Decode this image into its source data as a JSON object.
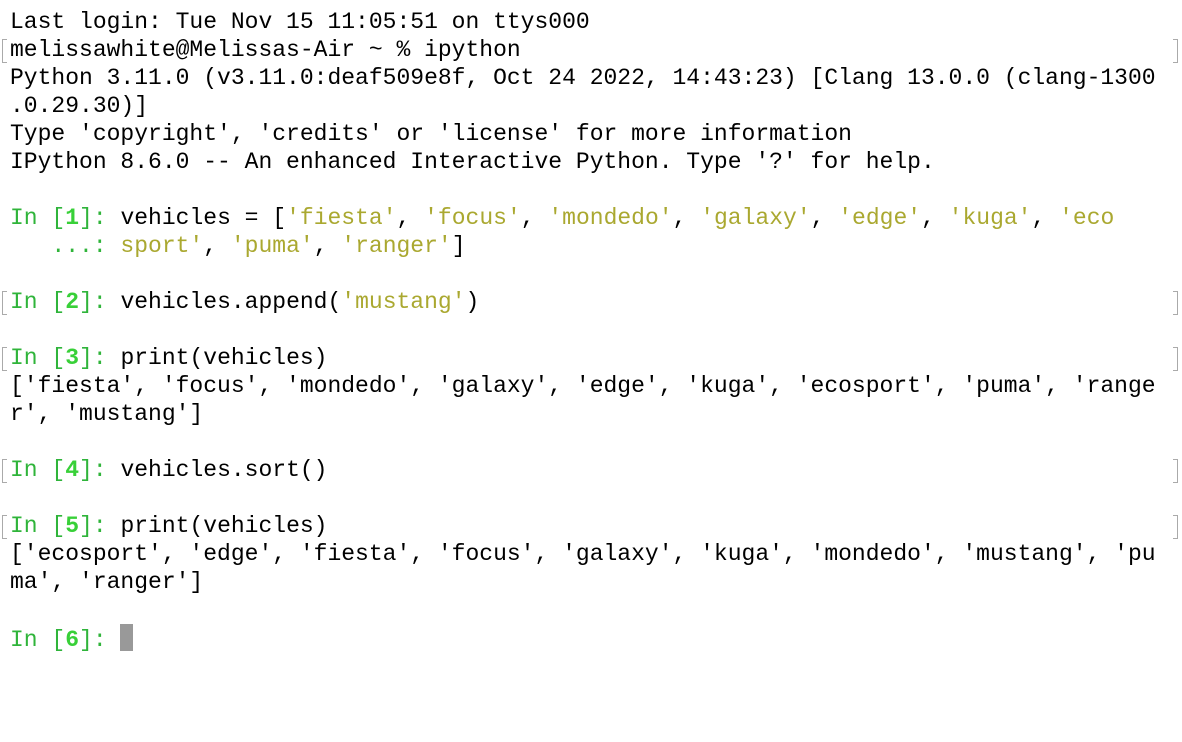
{
  "terminal": {
    "lines": [
      {
        "mark": false,
        "segs": [
          {
            "t": "Last login: Tue Nov 15 11:05:51 on ttys000"
          }
        ]
      },
      {
        "mark": true,
        "segs": [
          {
            "t": "melissawhite@Melissas-Air ~ % ipython"
          }
        ]
      },
      {
        "mark": false,
        "segs": [
          {
            "t": "Python 3.11.0 (v3.11.0:deaf509e8f, Oct 24 2022, 14:43:23) [Clang 13.0.0 (clang-1300"
          }
        ]
      },
      {
        "mark": false,
        "segs": [
          {
            "t": ".0.29.30)]"
          }
        ]
      },
      {
        "mark": false,
        "segs": [
          {
            "t": "Type 'copyright', 'credits' or 'license' for more information"
          }
        ]
      },
      {
        "mark": false,
        "segs": [
          {
            "t": "IPython 8.6.0 -- An enhanced Interactive Python. Type '?' for help."
          }
        ]
      },
      {
        "mark": false,
        "segs": []
      },
      {
        "mark": false,
        "segs": [
          {
            "t": "In [",
            "c": "g"
          },
          {
            "t": "1",
            "c": "gb"
          },
          {
            "t": "]: ",
            "c": "g"
          },
          {
            "t": "vehicles = ["
          },
          {
            "t": "'fiesta'",
            "c": "y"
          },
          {
            "t": ", "
          },
          {
            "t": "'focus'",
            "c": "y"
          },
          {
            "t": ", "
          },
          {
            "t": "'mondedo'",
            "c": "y"
          },
          {
            "t": ", "
          },
          {
            "t": "'galaxy'",
            "c": "y"
          },
          {
            "t": ", "
          },
          {
            "t": "'edge'",
            "c": "y"
          },
          {
            "t": ", "
          },
          {
            "t": "'kuga'",
            "c": "y"
          },
          {
            "t": ", "
          },
          {
            "t": "'eco",
            "c": "y"
          }
        ]
      },
      {
        "mark": false,
        "segs": [
          {
            "t": "   ...: ",
            "c": "g"
          },
          {
            "t": "sport'",
            "c": "y"
          },
          {
            "t": ", "
          },
          {
            "t": "'puma'",
            "c": "y"
          },
          {
            "t": ", "
          },
          {
            "t": "'ranger'",
            "c": "y"
          },
          {
            "t": "]"
          }
        ]
      },
      {
        "mark": false,
        "segs": []
      },
      {
        "mark": true,
        "segs": [
          {
            "t": "In [",
            "c": "g"
          },
          {
            "t": "2",
            "c": "gb"
          },
          {
            "t": "]: ",
            "c": "g"
          },
          {
            "t": "vehicles.append("
          },
          {
            "t": "'mustang'",
            "c": "y"
          },
          {
            "t": ")"
          }
        ]
      },
      {
        "mark": false,
        "segs": []
      },
      {
        "mark": true,
        "segs": [
          {
            "t": "In [",
            "c": "g"
          },
          {
            "t": "3",
            "c": "gb"
          },
          {
            "t": "]: ",
            "c": "g"
          },
          {
            "t": "print(vehicles)"
          }
        ]
      },
      {
        "mark": false,
        "segs": [
          {
            "t": "['fiesta', 'focus', 'mondedo', 'galaxy', 'edge', 'kuga', 'ecosport', 'puma', 'range"
          }
        ]
      },
      {
        "mark": false,
        "segs": [
          {
            "t": "r', 'mustang']"
          }
        ]
      },
      {
        "mark": false,
        "segs": []
      },
      {
        "mark": true,
        "segs": [
          {
            "t": "In [",
            "c": "g"
          },
          {
            "t": "4",
            "c": "gb"
          },
          {
            "t": "]: ",
            "c": "g"
          },
          {
            "t": "vehicles.sort()"
          }
        ]
      },
      {
        "mark": false,
        "segs": []
      },
      {
        "mark": true,
        "segs": [
          {
            "t": "In [",
            "c": "g"
          },
          {
            "t": "5",
            "c": "gb"
          },
          {
            "t": "]: ",
            "c": "g"
          },
          {
            "t": "print(vehicles)"
          }
        ]
      },
      {
        "mark": false,
        "segs": [
          {
            "t": "['ecosport', 'edge', 'fiesta', 'focus', 'galaxy', 'kuga', 'mondedo', 'mustang', 'pu"
          }
        ]
      },
      {
        "mark": false,
        "segs": [
          {
            "t": "ma', 'ranger']"
          }
        ]
      },
      {
        "mark": false,
        "segs": []
      },
      {
        "mark": false,
        "cursor": true,
        "segs": [
          {
            "t": "In [",
            "c": "g"
          },
          {
            "t": "6",
            "c": "gb"
          },
          {
            "t": "]: ",
            "c": "g"
          }
        ]
      }
    ]
  }
}
